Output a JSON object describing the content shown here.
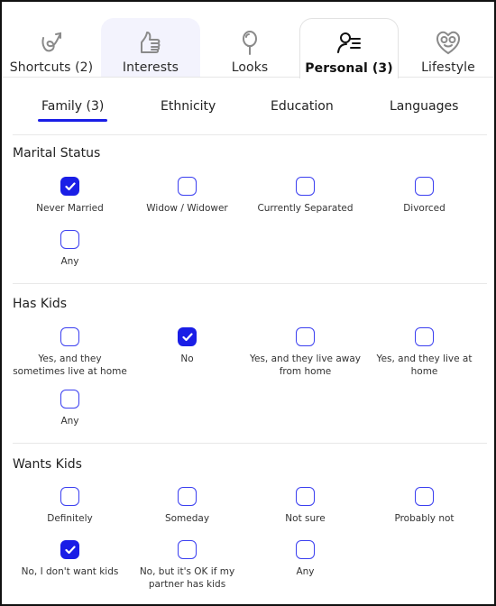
{
  "top_tabs": [
    {
      "label": "Shortcuts (2)",
      "icon": "shortcut-swirl-icon",
      "state": "normal"
    },
    {
      "label": "Interests",
      "icon": "thumbs-up-icon",
      "state": "hover"
    },
    {
      "label": "Looks",
      "icon": "balloon-icon",
      "state": "normal"
    },
    {
      "label": "Personal (3)",
      "icon": "person-list-icon",
      "state": "active"
    },
    {
      "label": "Lifestyle",
      "icon": "heart-face-icon",
      "state": "normal"
    }
  ],
  "sub_tabs": [
    {
      "label": "Family (3)",
      "active": true
    },
    {
      "label": "Ethnicity",
      "active": false
    },
    {
      "label": "Education",
      "active": false
    },
    {
      "label": "Languages",
      "active": false
    }
  ],
  "colors": {
    "accent": "#1a1ee6",
    "checkbox_border": "#3b3ff0",
    "hover_tab_bg": "#f3f3fd"
  },
  "sections": [
    {
      "title": "Marital Status",
      "options": [
        {
          "label": "Never Married",
          "checked": true
        },
        {
          "label": "Widow / Widower",
          "checked": false
        },
        {
          "label": "Currently Separated",
          "checked": false
        },
        {
          "label": "Divorced",
          "checked": false
        },
        {
          "label": "Any",
          "checked": false
        }
      ]
    },
    {
      "title": "Has Kids",
      "options": [
        {
          "label": "Yes, and they sometimes live at home",
          "checked": false
        },
        {
          "label": "No",
          "checked": true
        },
        {
          "label": "Yes, and they live away from home",
          "checked": false
        },
        {
          "label": "Yes, and they live at home",
          "checked": false
        },
        {
          "label": "Any",
          "checked": false
        }
      ]
    },
    {
      "title": "Wants Kids",
      "options": [
        {
          "label": "Definitely",
          "checked": false
        },
        {
          "label": "Someday",
          "checked": false
        },
        {
          "label": "Not sure",
          "checked": false
        },
        {
          "label": "Probably not",
          "checked": false
        },
        {
          "label": "No, I don't want kids",
          "checked": true
        },
        {
          "label": "No, but it's OK if my partner has kids",
          "checked": false
        },
        {
          "label": "Any",
          "checked": false
        }
      ]
    }
  ]
}
